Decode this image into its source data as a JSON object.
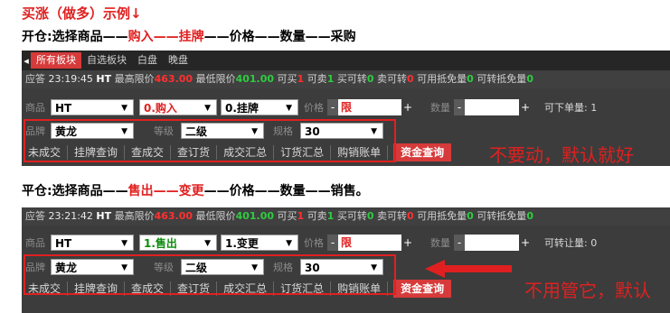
{
  "example_title": "买涨（做多）示例↓",
  "open_heading": {
    "prefix": "开仓:选择商品——",
    "buy": "购入——挂牌",
    "suffix": "——价格——数量——采购"
  },
  "close_heading": {
    "prefix": "平仓:选择商品——",
    "sell": "售出——变更",
    "suffix": "——价格——数量——销售。"
  },
  "panel1": {
    "tabs": [
      "所有板块",
      "自选板块",
      "白盘",
      "晚盘"
    ],
    "status": {
      "label": "应答",
      "time": "23:19:45",
      "code": "HT",
      "max_label": "最高限价",
      "max_value": "463.00",
      "min_label": "最低限价",
      "min_value": "401.00",
      "can_buy_label": "可买",
      "can_buy": "1",
      "can_sell_label": "可卖",
      "can_sell": "1",
      "buy_transfer_label": "买可转",
      "buy_transfer": "0",
      "sell_transfer_label": "卖可转",
      "sell_transfer": "0",
      "free_label": "可用抵免量",
      "free": "0",
      "transfer_free_label": "可转抵免量",
      "transfer_free": "0"
    },
    "row1": {
      "product_label": "商品",
      "product": "HT",
      "direction": "0.购入",
      "action": "0.挂牌",
      "price_label": "价格",
      "price_minus": "-",
      "price": "限",
      "price_plus": "+",
      "qty_label": "数量",
      "qty_minus": "-",
      "qty_plus": "+",
      "extra": "可下单量: 1"
    },
    "row2": {
      "brand_label": "品牌",
      "brand": "黄龙",
      "grade_label": "等级",
      "grade": "二级",
      "spec_label": "规格",
      "spec": "30"
    },
    "buttons": [
      "未成交",
      "挂牌查询",
      "查成交",
      "查订货",
      "成交汇总",
      "订货汇总",
      "购销账单"
    ],
    "capital_button": "资金查询"
  },
  "panel2": {
    "status": {
      "label": "应答",
      "time": "23:21:42",
      "code": "HT",
      "max_label": "最高限价",
      "max_value": "463.00",
      "min_label": "最低限价",
      "min_value": "401.00",
      "can_buy_label": "可买",
      "can_buy": "1",
      "can_sell_label": "可卖",
      "can_sell": "1",
      "buy_transfer_label": "买可转",
      "buy_transfer": "0",
      "sell_transfer_label": "卖可转",
      "sell_transfer": "0",
      "free_label": "可用抵免量",
      "free": "0",
      "transfer_free_label": "可转抵免量",
      "transfer_free": "0"
    },
    "row1": {
      "product_label": "商品",
      "product": "HT",
      "direction": "1.售出",
      "action": "1.变更",
      "price_label": "价格",
      "price_minus": "-",
      "price": "限",
      "price_plus": "+",
      "qty_label": "数量",
      "qty_minus": "-",
      "qty_plus": "+",
      "extra": "可转让量: 0"
    },
    "row2": {
      "brand_label": "品牌",
      "brand": "黄龙",
      "grade_label": "等级",
      "grade": "二级",
      "spec_label": "规格",
      "spec": "30"
    },
    "buttons": [
      "未成交",
      "挂牌查询",
      "查成交",
      "查订货",
      "成交汇总",
      "订货汇总",
      "购销账单"
    ],
    "capital_button": "资金查询"
  },
  "note1": "不要动，默认就好",
  "note2": "不用管它，默认",
  "colors": {
    "accent_red": "#e02020",
    "panel_bg": "#3c3c3c",
    "tab_active": "#d63a3a",
    "green": "#2ecc40"
  }
}
